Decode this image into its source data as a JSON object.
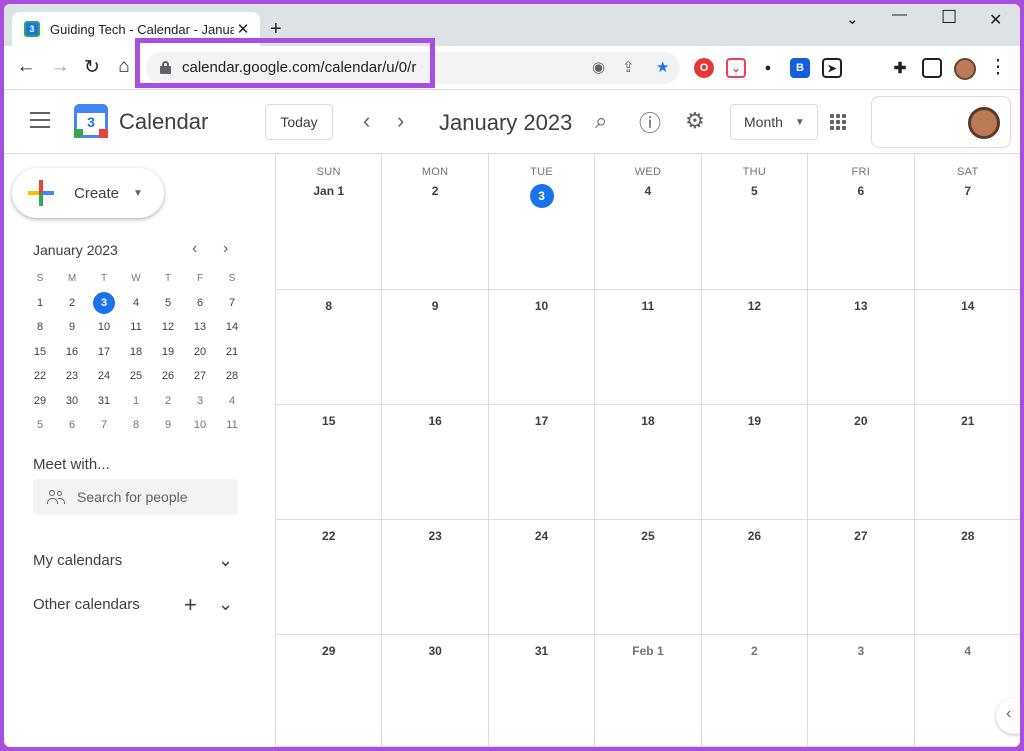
{
  "browser": {
    "tab_title": "Guiding Tech - Calendar - January",
    "tab_favicon": "3",
    "close_glyph": "✕",
    "newtab_glyph": "+",
    "minimize_glyph": "—",
    "maximize_glyph": "☐",
    "winclose_glyph": "✕",
    "tabsearch_glyph": "⌄",
    "url": "calendar.google.com/calendar/u/0/r",
    "highlight_color": "#a64fe0",
    "extension_icons": [
      "opera-icon",
      "pocket-icon",
      "spy-icon",
      "bitwarden-icon",
      "telegram-icon",
      "puzzle-icon",
      "sidepanel-icon"
    ]
  },
  "header": {
    "logo_num": "3",
    "app_name": "Calendar",
    "today_label": "Today",
    "current_month": "January 2023",
    "view": "Month",
    "prev_glyph": "‹",
    "next_glyph": "›"
  },
  "sidebar": {
    "create_label": "Create",
    "mini_title": "January 2023",
    "mini_dow": [
      "S",
      "M",
      "T",
      "W",
      "T",
      "F",
      "S"
    ],
    "mini_weeks": [
      [
        "1",
        "2",
        "3",
        "4",
        "5",
        "6",
        "7"
      ],
      [
        "8",
        "9",
        "10",
        "11",
        "12",
        "13",
        "14"
      ],
      [
        "15",
        "16",
        "17",
        "18",
        "19",
        "20",
        "21"
      ],
      [
        "22",
        "23",
        "24",
        "25",
        "26",
        "27",
        "28"
      ],
      [
        "29",
        "30",
        "31",
        "1",
        "2",
        "3",
        "4"
      ],
      [
        "5",
        "6",
        "7",
        "8",
        "9",
        "10",
        "11"
      ]
    ],
    "meet_title": "Meet with...",
    "people_placeholder": "Search for people",
    "my_calendars": "My calendars",
    "other_calendars": "Other calendars"
  },
  "month": {
    "dow": [
      "SUN",
      "MON",
      "TUE",
      "WED",
      "THU",
      "FRI",
      "SAT"
    ],
    "weeks": [
      [
        "Jan 1",
        "2",
        "3",
        "4",
        "5",
        "6",
        "7"
      ],
      [
        "8",
        "9",
        "10",
        "11",
        "12",
        "13",
        "14"
      ],
      [
        "15",
        "16",
        "17",
        "18",
        "19",
        "20",
        "21"
      ],
      [
        "22",
        "23",
        "24",
        "25",
        "26",
        "27",
        "28"
      ],
      [
        "29",
        "30",
        "31",
        "Feb 1",
        "2",
        "3",
        "4"
      ]
    ],
    "today": "3"
  },
  "colors": {
    "accent": "#1a73e8",
    "frame": "#a64fe0"
  }
}
